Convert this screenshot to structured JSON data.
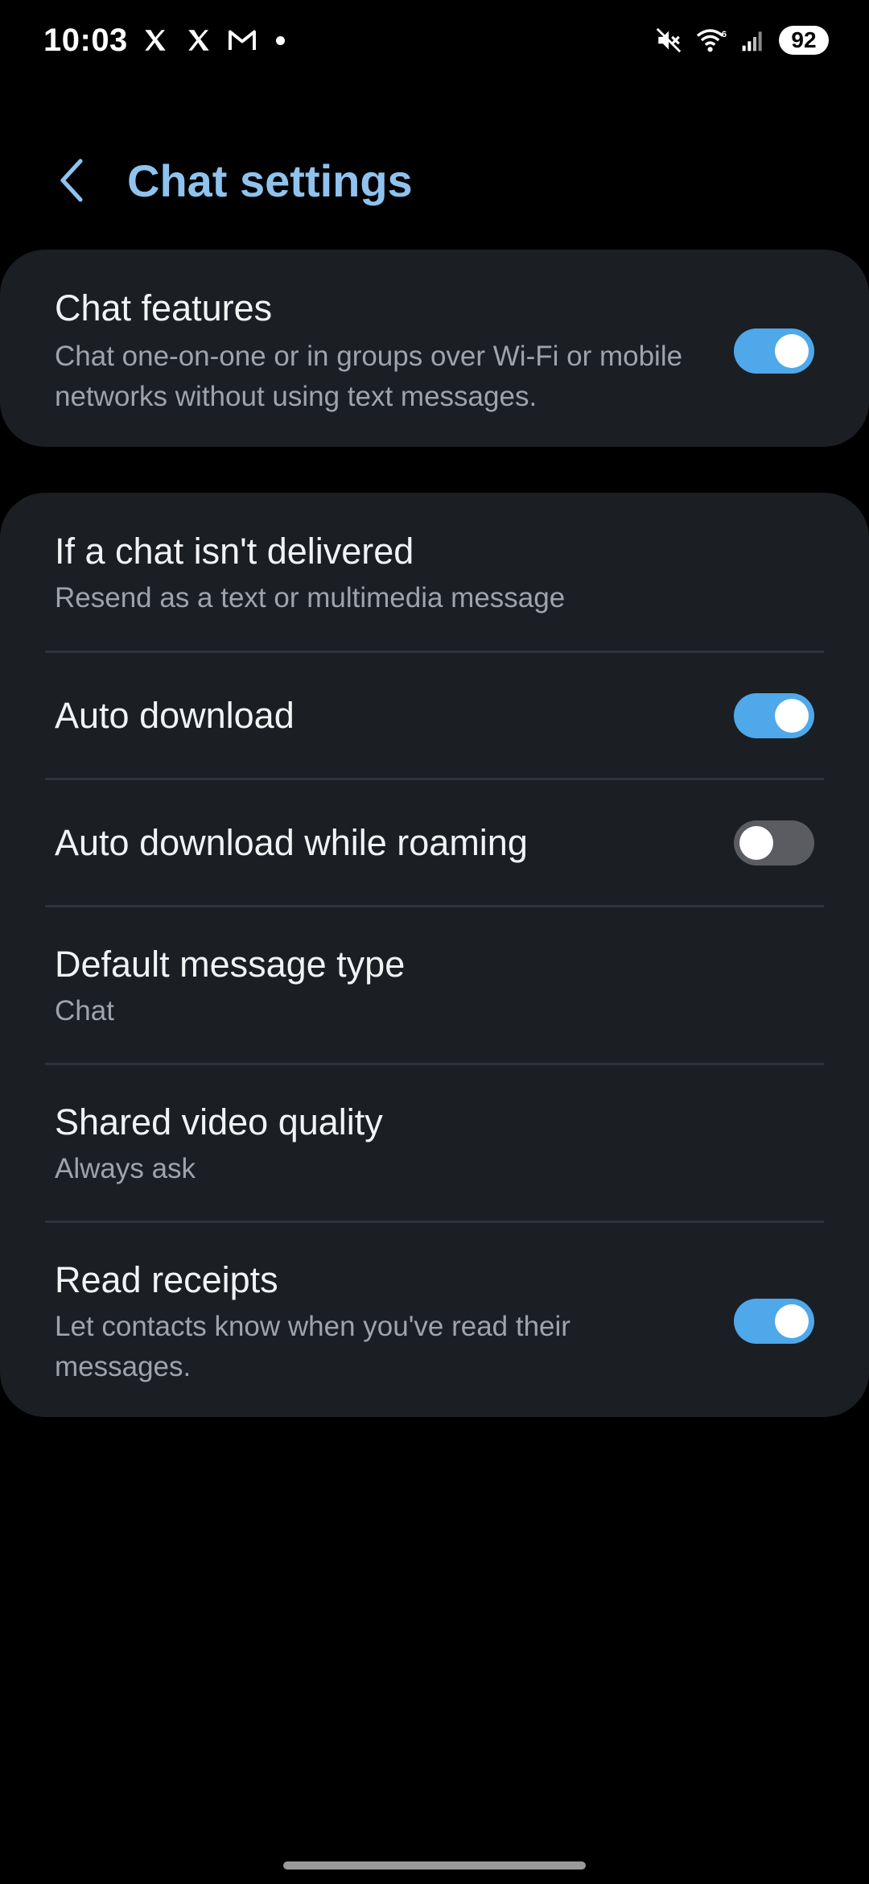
{
  "status_bar": {
    "time": "10:03",
    "notification_icons": [
      "x-icon",
      "x-icon",
      "gmail-icon",
      "dot-icon"
    ],
    "system_icons": [
      "mute-icon",
      "wifi-icon",
      "signal-icon"
    ],
    "wifi_badge": "6",
    "battery": "92"
  },
  "header": {
    "title": "Chat settings",
    "back_icon": "chevron-left-icon"
  },
  "chat_features": {
    "title": "Chat features",
    "subtitle": "Chat one-on-one or in groups over Wi-Fi or mobile networks without using text messages.",
    "enabled": true
  },
  "settings": {
    "undelivered": {
      "title": "If a chat isn't delivered",
      "value": "Resend as a text or multimedia message"
    },
    "auto_download": {
      "title": "Auto download",
      "enabled": true
    },
    "auto_download_roaming": {
      "title": "Auto download while roaming",
      "enabled": false
    },
    "default_message_type": {
      "title": "Default message type",
      "value": "Chat"
    },
    "shared_video_quality": {
      "title": "Shared video quality",
      "value": "Always ask"
    },
    "read_receipts": {
      "title": "Read receipts",
      "subtitle": "Let contacts know when you've read their messages.",
      "enabled": true
    }
  },
  "colors": {
    "accent": "#4ea8e9",
    "title": "#8fc3ee",
    "card": "#1b1e23",
    "background": "#000000"
  }
}
